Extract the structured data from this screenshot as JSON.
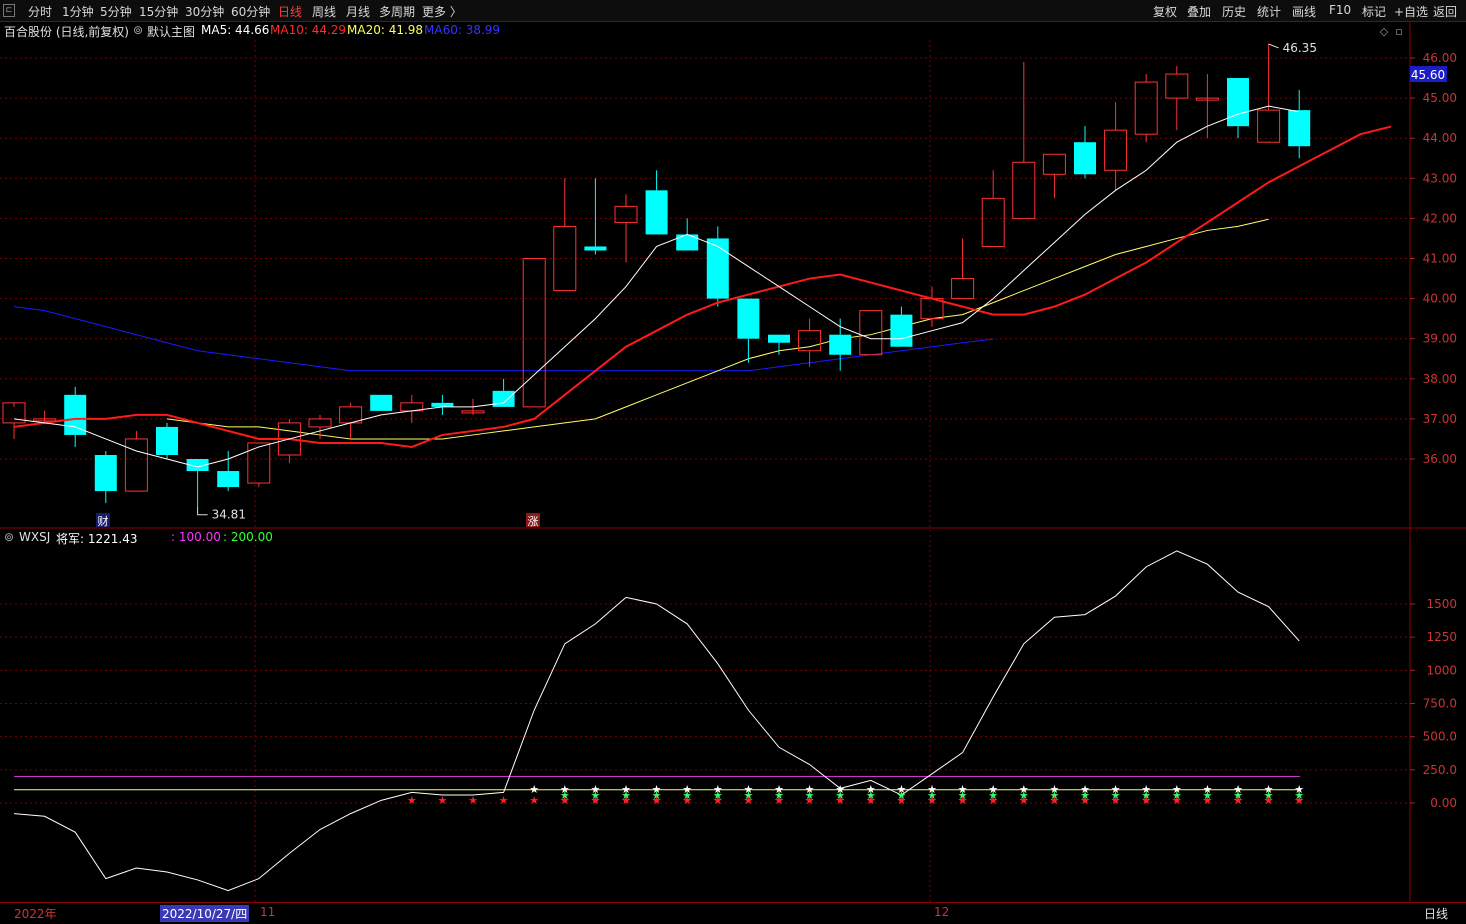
{
  "toolbar": {
    "period_tabs": [
      "分时",
      "1分钟",
      "5分钟",
      "15分钟",
      "30分钟",
      "60分钟",
      "日线",
      "周线",
      "月线",
      "多周期",
      "更多 〉"
    ],
    "active_tab": "日线",
    "right_buttons": [
      "复权",
      "叠加",
      "历史",
      "统计",
      "画线",
      "F10",
      "标记",
      "+自选",
      "返回"
    ]
  },
  "main_info": {
    "stock": "百合股份 (日线,前复权)",
    "template": "默认主图",
    "ma5_label": "MA5: 44.66",
    "ma10_label": "MA10: 44.29",
    "ma20_label": "MA20: 41.98",
    "ma60_label": "MA60: 38.99"
  },
  "sub_info": {
    "indicator": "WXSJ",
    "general_label": "将军: 1221.43",
    "line1_label": ": 100.00",
    "line2_label": ": 200.00"
  },
  "colors": {
    "up": "#ff3232",
    "down": "#00ffff",
    "ma5": "#ffffff",
    "ma10": "#ff1a1a",
    "ma20": "#ffff66",
    "ma60": "#1a1aff",
    "grid": "#7a0000",
    "axis_text": "#cc3333",
    "line100": "#ffff66",
    "line200": "#cc33cc",
    "star_red": "#ff2020",
    "star_white": "#ffffff",
    "star_pink": "#ff33aa"
  },
  "price_axis": {
    "ticks": [
      "46.00",
      "45.00",
      "44.00",
      "43.00",
      "42.00",
      "41.00",
      "40.00",
      "39.00",
      "38.00",
      "37.00",
      "36.00"
    ],
    "current_price": "45.60"
  },
  "sub_axis": {
    "ticks": [
      "1500",
      "1250",
      "1000",
      "750.0",
      "500.0",
      "250.0",
      "0.00"
    ]
  },
  "annotations": {
    "high": "46.35",
    "low": "34.81",
    "badge_cai": "财",
    "badge_zhang": "涨"
  },
  "statusbar": {
    "year": "2022年",
    "cursor_date": "2022/10/27/四",
    "month_11": "11",
    "month_12": "12",
    "period": "日线"
  },
  "chart_data": {
    "type": "candlestick",
    "candles": [
      {
        "o": 36.9,
        "h": 37.3,
        "l": 36.5,
        "c": 37.4
      },
      {
        "o": 37.0,
        "h": 37.2,
        "l": 36.9,
        "c": 37.0
      },
      {
        "o": 37.6,
        "h": 37.8,
        "l": 36.3,
        "c": 36.6
      },
      {
        "o": 36.1,
        "h": 36.2,
        "l": 34.9,
        "c": 35.2
      },
      {
        "o": 35.2,
        "h": 36.7,
        "l": 35.2,
        "c": 36.5
      },
      {
        "o": 36.8,
        "h": 36.9,
        "l": 36.0,
        "c": 36.1
      },
      {
        "o": 36.0,
        "h": 36.0,
        "l": 34.81,
        "c": 35.7
      },
      {
        "o": 35.7,
        "h": 36.2,
        "l": 35.2,
        "c": 35.3
      },
      {
        "o": 35.4,
        "h": 36.4,
        "l": 35.3,
        "c": 36.4
      },
      {
        "o": 36.1,
        "h": 37.0,
        "l": 35.9,
        "c": 36.9
      },
      {
        "o": 36.8,
        "h": 37.1,
        "l": 36.5,
        "c": 37.0
      },
      {
        "o": 36.9,
        "h": 37.4,
        "l": 36.5,
        "c": 37.3
      },
      {
        "o": 37.6,
        "h": 37.6,
        "l": 37.2,
        "c": 37.2
      },
      {
        "o": 37.2,
        "h": 37.6,
        "l": 36.9,
        "c": 37.4
      },
      {
        "o": 37.4,
        "h": 37.6,
        "l": 37.1,
        "c": 37.3
      },
      {
        "o": 37.2,
        "h": 37.5,
        "l": 37.1,
        "c": 37.2
      },
      {
        "o": 37.7,
        "h": 38.0,
        "l": 37.3,
        "c": 37.3
      },
      {
        "o": 37.3,
        "h": 41.0,
        "l": 37.3,
        "c": 41.0
      },
      {
        "o": 40.2,
        "h": 43.0,
        "l": 40.2,
        "c": 41.8
      },
      {
        "o": 41.3,
        "h": 43.0,
        "l": 41.1,
        "c": 41.2
      },
      {
        "o": 41.9,
        "h": 42.6,
        "l": 40.9,
        "c": 42.3
      },
      {
        "o": 42.7,
        "h": 43.2,
        "l": 41.6,
        "c": 41.6
      },
      {
        "o": 41.6,
        "h": 42.0,
        "l": 41.2,
        "c": 41.2
      },
      {
        "o": 41.5,
        "h": 41.8,
        "l": 39.8,
        "c": 40.0
      },
      {
        "o": 40.0,
        "h": 40.0,
        "l": 38.4,
        "c": 39.0
      },
      {
        "o": 39.1,
        "h": 39.1,
        "l": 38.6,
        "c": 38.9
      },
      {
        "o": 38.7,
        "h": 39.5,
        "l": 38.3,
        "c": 39.2
      },
      {
        "o": 39.1,
        "h": 39.5,
        "l": 38.2,
        "c": 38.6
      },
      {
        "o": 38.6,
        "h": 39.7,
        "l": 38.6,
        "c": 39.7
      },
      {
        "o": 39.6,
        "h": 39.8,
        "l": 38.8,
        "c": 38.8
      },
      {
        "o": 39.5,
        "h": 40.3,
        "l": 39.3,
        "c": 40.0
      },
      {
        "o": 40.0,
        "h": 41.5,
        "l": 40.0,
        "c": 40.5
      },
      {
        "o": 41.3,
        "h": 43.2,
        "l": 41.3,
        "c": 42.5
      },
      {
        "o": 42.0,
        "h": 45.9,
        "l": 42.0,
        "c": 43.4
      },
      {
        "o": 43.1,
        "h": 43.6,
        "l": 42.5,
        "c": 43.6
      },
      {
        "o": 43.9,
        "h": 44.3,
        "l": 43.0,
        "c": 43.1
      },
      {
        "o": 43.2,
        "h": 44.9,
        "l": 42.7,
        "c": 44.2
      },
      {
        "o": 44.1,
        "h": 45.6,
        "l": 43.9,
        "c": 45.4
      },
      {
        "o": 45.0,
        "h": 45.8,
        "l": 44.2,
        "c": 45.6
      },
      {
        "o": 45.0,
        "h": 45.6,
        "l": 44.0,
        "c": 45.0
      },
      {
        "o": 45.5,
        "h": 45.5,
        "l": 44.0,
        "c": 44.3
      },
      {
        "o": 43.9,
        "h": 46.35,
        "l": 43.9,
        "c": 44.7
      },
      {
        "o": 44.7,
        "h": 45.2,
        "l": 43.5,
        "c": 43.8
      }
    ],
    "ma5": [
      37.0,
      36.9,
      36.8,
      36.5,
      36.2,
      36.0,
      35.8,
      36.0,
      36.3,
      36.5,
      36.7,
      36.9,
      37.1,
      37.2,
      37.3,
      37.3,
      37.4,
      38.1,
      38.8,
      39.5,
      40.3,
      41.3,
      41.6,
      41.3,
      40.8,
      40.3,
      39.8,
      39.3,
      39.0,
      39.0,
      39.2,
      39.4,
      40.0,
      40.7,
      41.4,
      42.1,
      42.7,
      43.2,
      43.9,
      44.3,
      44.6,
      44.8,
      44.66
    ],
    "ma10": [
      36.8,
      36.9,
      37.0,
      37.0,
      37.1,
      37.1,
      36.9,
      36.7,
      36.5,
      36.5,
      36.4,
      36.4,
      36.4,
      36.3,
      36.6,
      36.7,
      36.8,
      37.0,
      37.6,
      38.2,
      38.8,
      39.2,
      39.6,
      39.9,
      40.1,
      40.3,
      40.5,
      40.6,
      40.4,
      40.2,
      40.0,
      39.8,
      39.6,
      39.6,
      39.8,
      40.1,
      40.5,
      40.9,
      41.4,
      41.9,
      42.4,
      42.9,
      43.3,
      43.7,
      44.1,
      44.29
    ],
    "ma20": [
      37.0,
      36.9,
      36.8,
      36.8,
      36.7,
      36.6,
      36.5,
      36.5,
      36.5,
      36.5,
      36.6,
      36.7,
      36.8,
      36.9,
      37.0,
      37.3,
      37.6,
      37.9,
      38.2,
      38.5,
      38.7,
      38.8,
      39.0,
      39.1,
      39.3,
      39.5,
      39.6,
      39.9,
      40.2,
      40.5,
      40.8,
      41.1,
      41.3,
      41.5,
      41.7,
      41.8,
      41.98
    ],
    "ma60": [
      39.8,
      39.7,
      39.5,
      39.3,
      39.1,
      38.9,
      38.7,
      38.6,
      38.5,
      38.4,
      38.3,
      38.2,
      38.2,
      38.2,
      38.2,
      38.2,
      38.2,
      38.2,
      38.2,
      38.2,
      38.2,
      38.2,
      38.2,
      38.2,
      38.2,
      38.3,
      38.4,
      38.5,
      38.6,
      38.7,
      38.8,
      38.9,
      38.99
    ],
    "wxsj": [
      -80,
      -100,
      -220,
      -570,
      -490,
      -520,
      -580,
      -660,
      -570,
      -380,
      -200,
      -80,
      20,
      80,
      60,
      60,
      80,
      700,
      1200,
      1350,
      1550,
      1500,
      1350,
      1050,
      700,
      420,
      290,
      110,
      170,
      60,
      220,
      380,
      800,
      1200,
      1400,
      1420,
      1560,
      1780,
      1900,
      1800,
      1590,
      1480,
      1221.43
    ],
    "line100": 100,
    "line200": 200
  }
}
